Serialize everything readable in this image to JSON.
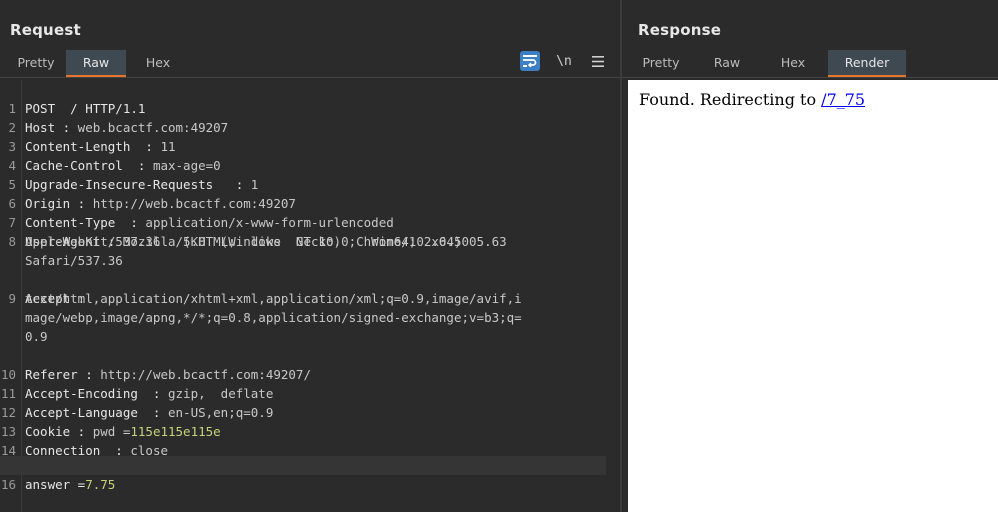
{
  "request": {
    "title": "Request",
    "tabs": [
      "Pretty",
      "Raw",
      "Hex"
    ],
    "active_tab": "Raw",
    "toolbar": {
      "wrap_icon": "wrap-lines-icon",
      "newline_label": "\\n",
      "menu_icon": "hamburger-menu-icon"
    },
    "lines": [
      {
        "n": "1",
        "key": "POST  / HTTP/1.1",
        "val": ""
      },
      {
        "n": "2",
        "key": "Host :",
        "val": " web.bcactf.com:49207"
      },
      {
        "n": "3",
        "key": "Content-Length  :",
        "val": " 11"
      },
      {
        "n": "4",
        "key": "Cache-Control  :",
        "val": " max-age=0"
      },
      {
        "n": "5",
        "key": "Upgrade-Insecure-Requests   :",
        "val": " 1"
      },
      {
        "n": "6",
        "key": "Origin :",
        "val": " http://web.bcactf.com:49207"
      },
      {
        "n": "7",
        "key": "Content-Type  :",
        "val": " application/x-www-form-urlencoded"
      },
      {
        "n": "8",
        "key": "User-Agent :",
        "val": " Mozilla/5.0  (Windows  NT 10.0;  Win64;  x64)"
      },
      {
        "n": "",
        "key": "",
        "val": "AppleWebKit/537.36   (KHTML,  like  Gecko)  Chrome/102.0.5005.63"
      },
      {
        "n": "",
        "key": "",
        "val": "Safari/537.36"
      },
      {
        "n": "9",
        "key": "Accept :",
        "val": ""
      },
      {
        "n": "",
        "key": "",
        "val": "text/html,application/xhtml+xml,application/xml;q=0.9,image/avif,i"
      },
      {
        "n": "",
        "key": "",
        "val": "mage/webp,image/apng,*/*;q=0.8,application/signed-exchange;v=b3;q="
      },
      {
        "n": "",
        "key": "",
        "val": "0.9"
      },
      {
        "n": "10",
        "key": "Referer :",
        "val": " http://web.bcactf.com:49207/"
      },
      {
        "n": "11",
        "key": "Accept-Encoding  :",
        "val": " gzip,  deflate"
      },
      {
        "n": "12",
        "key": "Accept-Language  :",
        "val": " en-US,en;q=0.9"
      },
      {
        "n": "13",
        "key": "Cookie :",
        "val": " pwd =",
        "hl": "115e115e115e"
      },
      {
        "n": "14",
        "key": "Connection  :",
        "val": " close"
      },
      {
        "n": "15",
        "key": "",
        "val": ""
      },
      {
        "n": "16",
        "key": "answer =",
        "val": "",
        "hl": "7.75"
      }
    ]
  },
  "response": {
    "title": "Response",
    "tabs": [
      "Pretty",
      "Raw",
      "Hex",
      "Render"
    ],
    "active_tab": "Render",
    "render_text": "Found. Redirecting to ",
    "render_link": "/7_75"
  },
  "colors": {
    "accent": "#e4772b",
    "active_tool": "#3d7fc4",
    "highlight": "#c7d27a"
  }
}
